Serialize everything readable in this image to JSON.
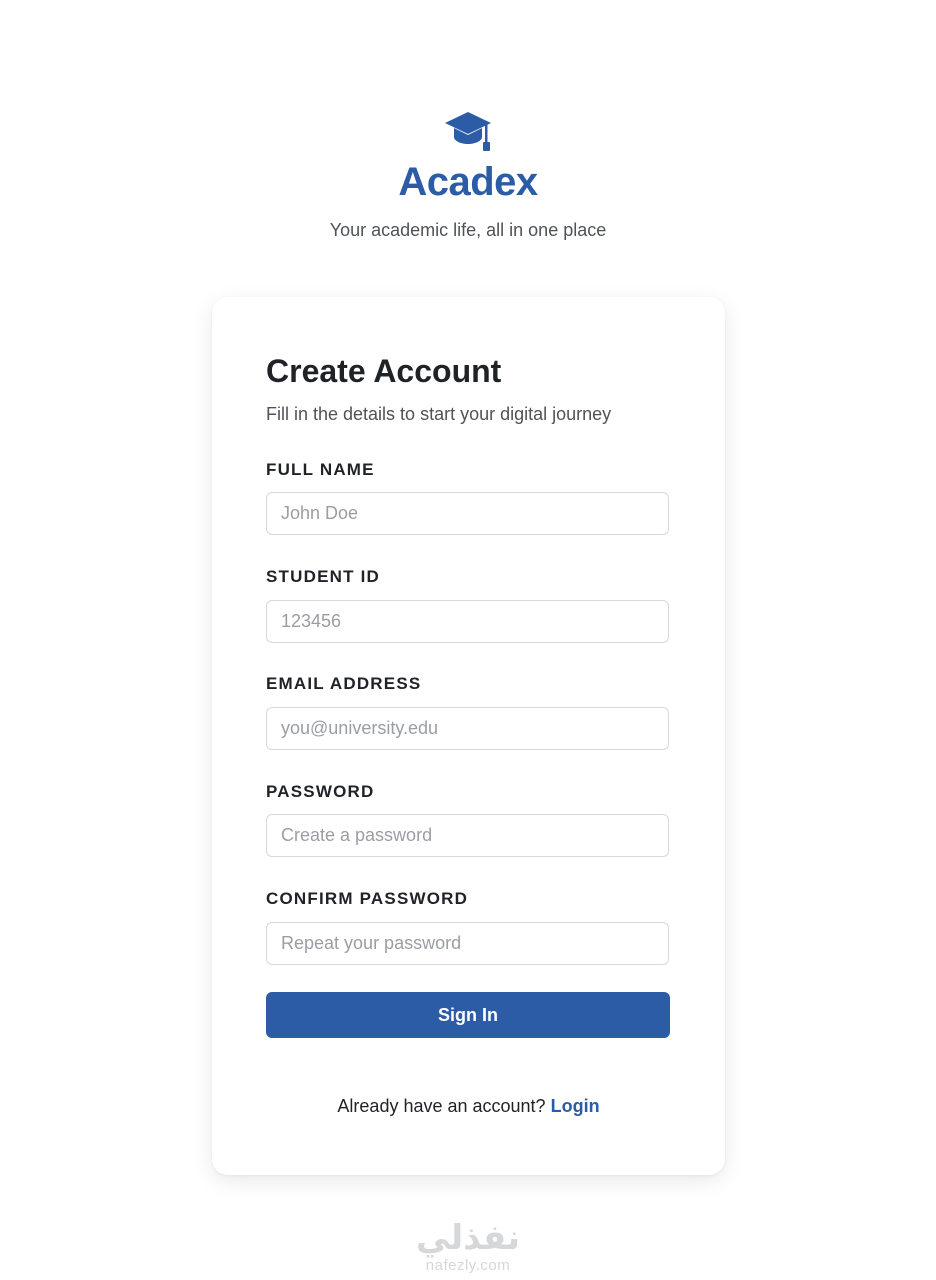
{
  "brand": {
    "icon": "graduation-cap-icon",
    "name": "Acadex",
    "tagline": "Your academic life, all in one place",
    "color": "#2b5ca5"
  },
  "form": {
    "title": "Create Account",
    "subtitle": "Fill in the details to start your digital journey",
    "fields": [
      {
        "label": "FULL NAME",
        "value": "",
        "placeholder": "John Doe"
      },
      {
        "label": "STUDENT ID",
        "value": "",
        "placeholder": "123456"
      },
      {
        "label": "EMAIL ADDRESS",
        "value": "",
        "placeholder": "you@university.edu"
      },
      {
        "label": "PASSWORD",
        "value": "",
        "placeholder": "Create a password"
      },
      {
        "label": "CONFIRM PASSWORD",
        "value": "",
        "placeholder": "Repeat your password"
      }
    ],
    "submit_label": "Sign In",
    "login_prompt": "Already have an account?",
    "login_link": "Login"
  },
  "watermark": {
    "logo_text": "نفذلي",
    "url": "nafezly.com"
  }
}
